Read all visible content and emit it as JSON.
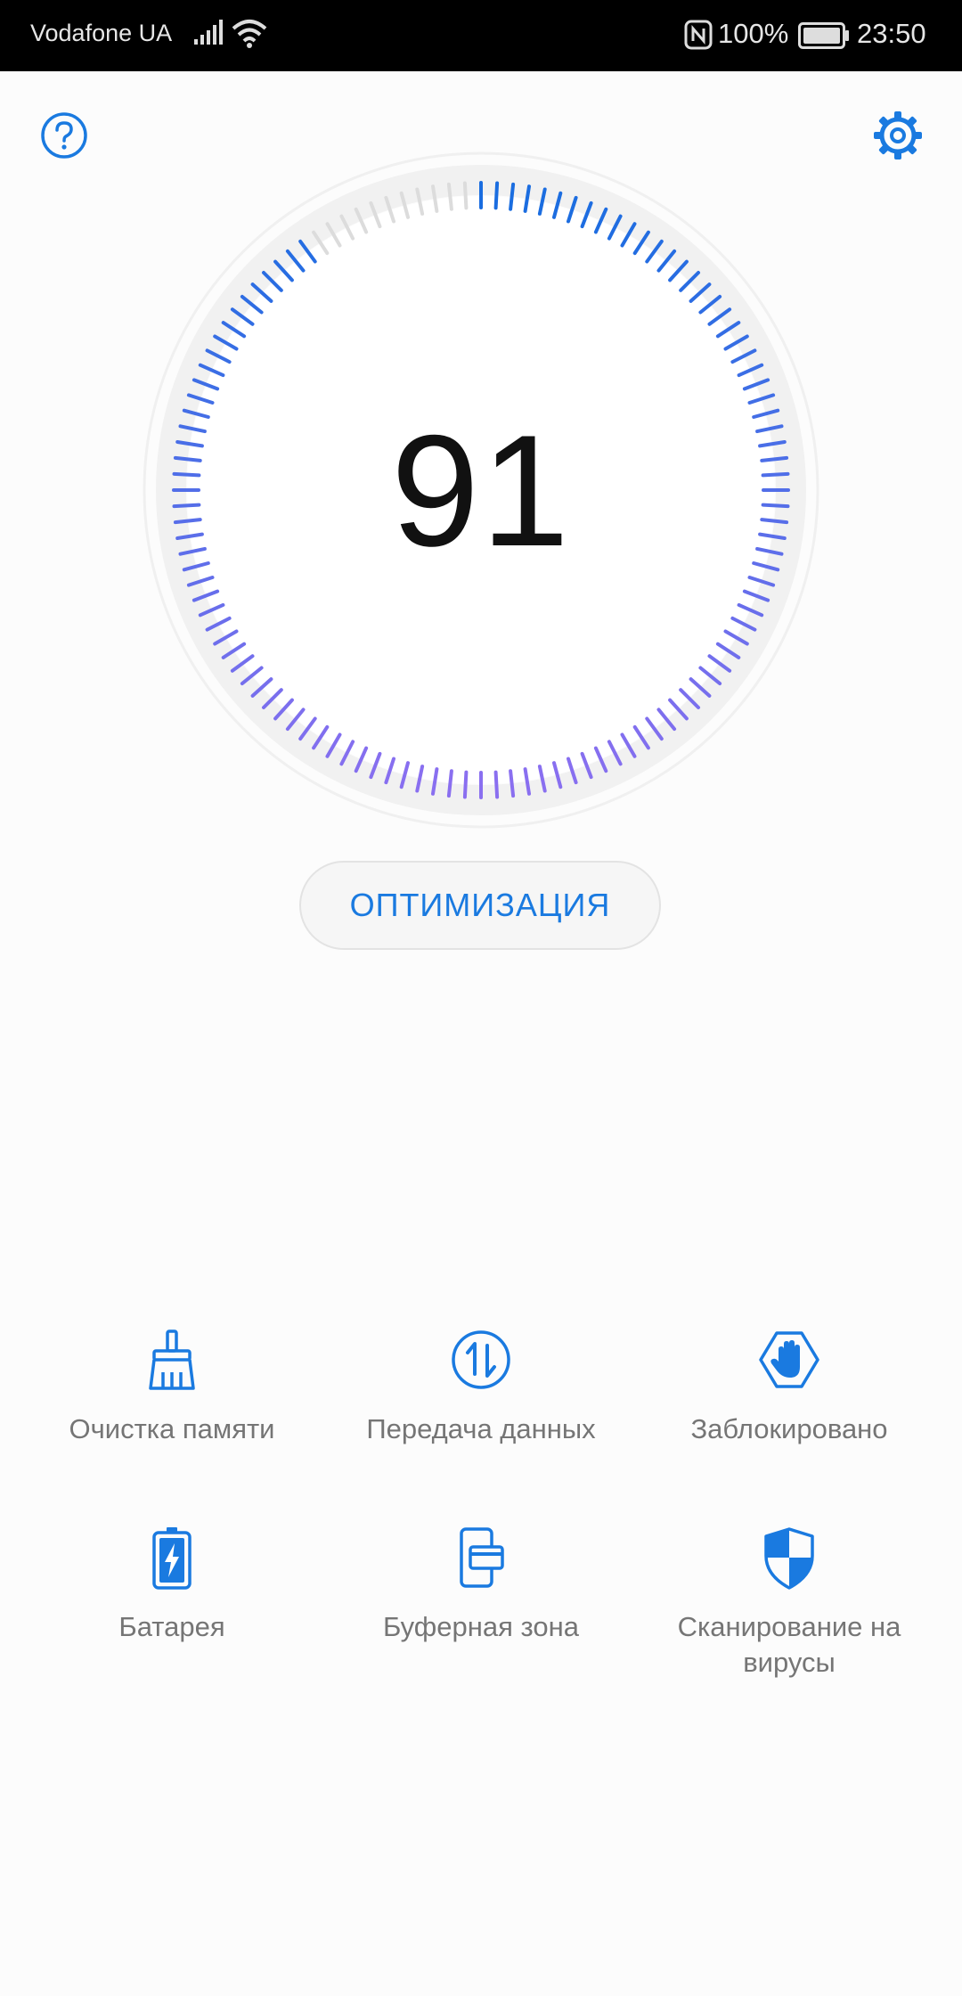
{
  "status_bar": {
    "carrier": "Vodafone UA",
    "battery_percent": "100%",
    "time": "23:50",
    "icons": [
      "signal-icon",
      "wifi-icon",
      "nfc-icon",
      "battery-icon"
    ]
  },
  "header": {
    "help_icon": "help-icon",
    "settings_icon": "gear-icon"
  },
  "gauge": {
    "score": "91",
    "level": 0.91,
    "colors": {
      "start": "#1a6de0",
      "end": "#8a6ff0",
      "track": "#dcdcdc"
    }
  },
  "optimize_button": {
    "label": "ОПТИМИЗАЦИЯ"
  },
  "tools": [
    {
      "label": "Очистка памяти",
      "icon": "broom-icon"
    },
    {
      "label": "Передача данных",
      "icon": "data-transfer-icon"
    },
    {
      "label": "Заблокировано",
      "icon": "blocked-hand-icon"
    },
    {
      "label": "Батарея",
      "icon": "battery-charge-icon"
    },
    {
      "label": "Буферная зона",
      "icon": "buffer-zone-icon"
    },
    {
      "label": "Сканирование на вирусы",
      "icon": "shield-icon"
    }
  ],
  "colors": {
    "accent": "#1a7ae0",
    "text_secondary": "#757575"
  }
}
